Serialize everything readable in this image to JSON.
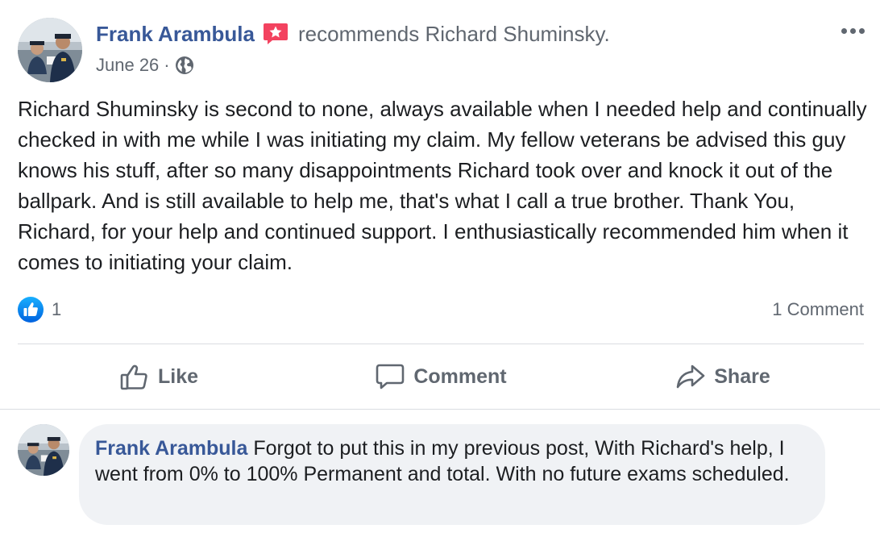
{
  "post": {
    "author": "Frank Arambula",
    "action_text": "recommends Richard Shuminsky.",
    "date": "June 26",
    "separator": "·",
    "privacy_icon": "globe-icon",
    "recommend_icon": "star-recommendation-icon",
    "menu_icon": "more-options-icon",
    "body": "Richard Shuminsky is second to none, always available when I needed help and continually checked in with me while I was initiating my claim. My fellow veterans be advised this guy knows his stuff, after so many disappointments Richard took over and knock it out of the ballpark. And is still available to help me, that's what I call a true brother. Thank You, Richard, for your help and continued support. I enthusiastically recommended him when it comes to initiating your claim."
  },
  "reactions": {
    "icon": "like-reaction-icon",
    "count": "1",
    "comments_label": "1 Comment"
  },
  "actions": {
    "like": "Like",
    "comment": "Comment",
    "share": "Share"
  },
  "comment": {
    "author": "Frank Arambula",
    "text": " Forgot to put this in my previous post, With Richard's help, I went from 0% to 100% Permanent and total. With no future exams scheduled."
  },
  "colors": {
    "link_blue": "#385898",
    "secondary_text": "#606770",
    "recommend_red": "#f3425f",
    "like_blue": "#1877f2",
    "bubble_bg": "#f0f2f5"
  }
}
